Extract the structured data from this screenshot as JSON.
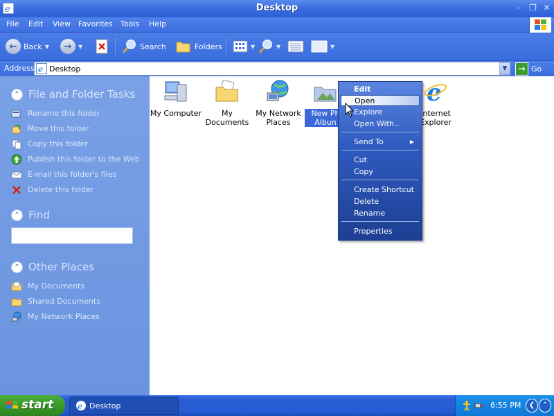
{
  "window": {
    "title": "Desktop"
  },
  "menubar": {
    "items": [
      "File",
      "Edit",
      "View",
      "Favorites",
      "Tools",
      "Help"
    ]
  },
  "toolbar": {
    "back_label": "Back",
    "search_label": "Search",
    "folders_label": "Folders"
  },
  "address": {
    "label": "Address",
    "value": "Desktop",
    "go_label": "Go"
  },
  "taskpane": {
    "file_tasks": {
      "title": "File and Folder Tasks",
      "items": [
        "Rename this folder",
        "Move this folder",
        "Copy this folder",
        "Publish this folder to the Web",
        "E-mail this folder's files",
        "Delete this folder"
      ]
    },
    "find": {
      "title": "Find",
      "value": ""
    },
    "other_places": {
      "title": "Other Places",
      "items": [
        "My Documents",
        "Shared Documents",
        "My Network Places"
      ]
    }
  },
  "desktop": {
    "icons": [
      {
        "line1": "My Computer",
        "line2": ""
      },
      {
        "line1": "My Documents",
        "line2": ""
      },
      {
        "line1": "My Network",
        "line2": "Places"
      },
      {
        "line1": "New Ph",
        "line2": "Albun"
      },
      {
        "line1": "Internet",
        "line2": "Explorer"
      }
    ]
  },
  "context_menu": {
    "items": [
      "Edit",
      "Open",
      "Explore",
      "Open With...",
      "Send To",
      "Cut",
      "Copy",
      "Create Shortcut",
      "Delete",
      "Rename",
      "Properties"
    ]
  },
  "taskbar": {
    "start_label": "start",
    "task_label": "Desktop",
    "clock": "6:55 PM"
  },
  "colors": {
    "title_blue": "#3a6fe0",
    "pane_blue": "#7aa1e6",
    "start_green": "#389b28",
    "tray_blue": "#1a8fe8"
  }
}
